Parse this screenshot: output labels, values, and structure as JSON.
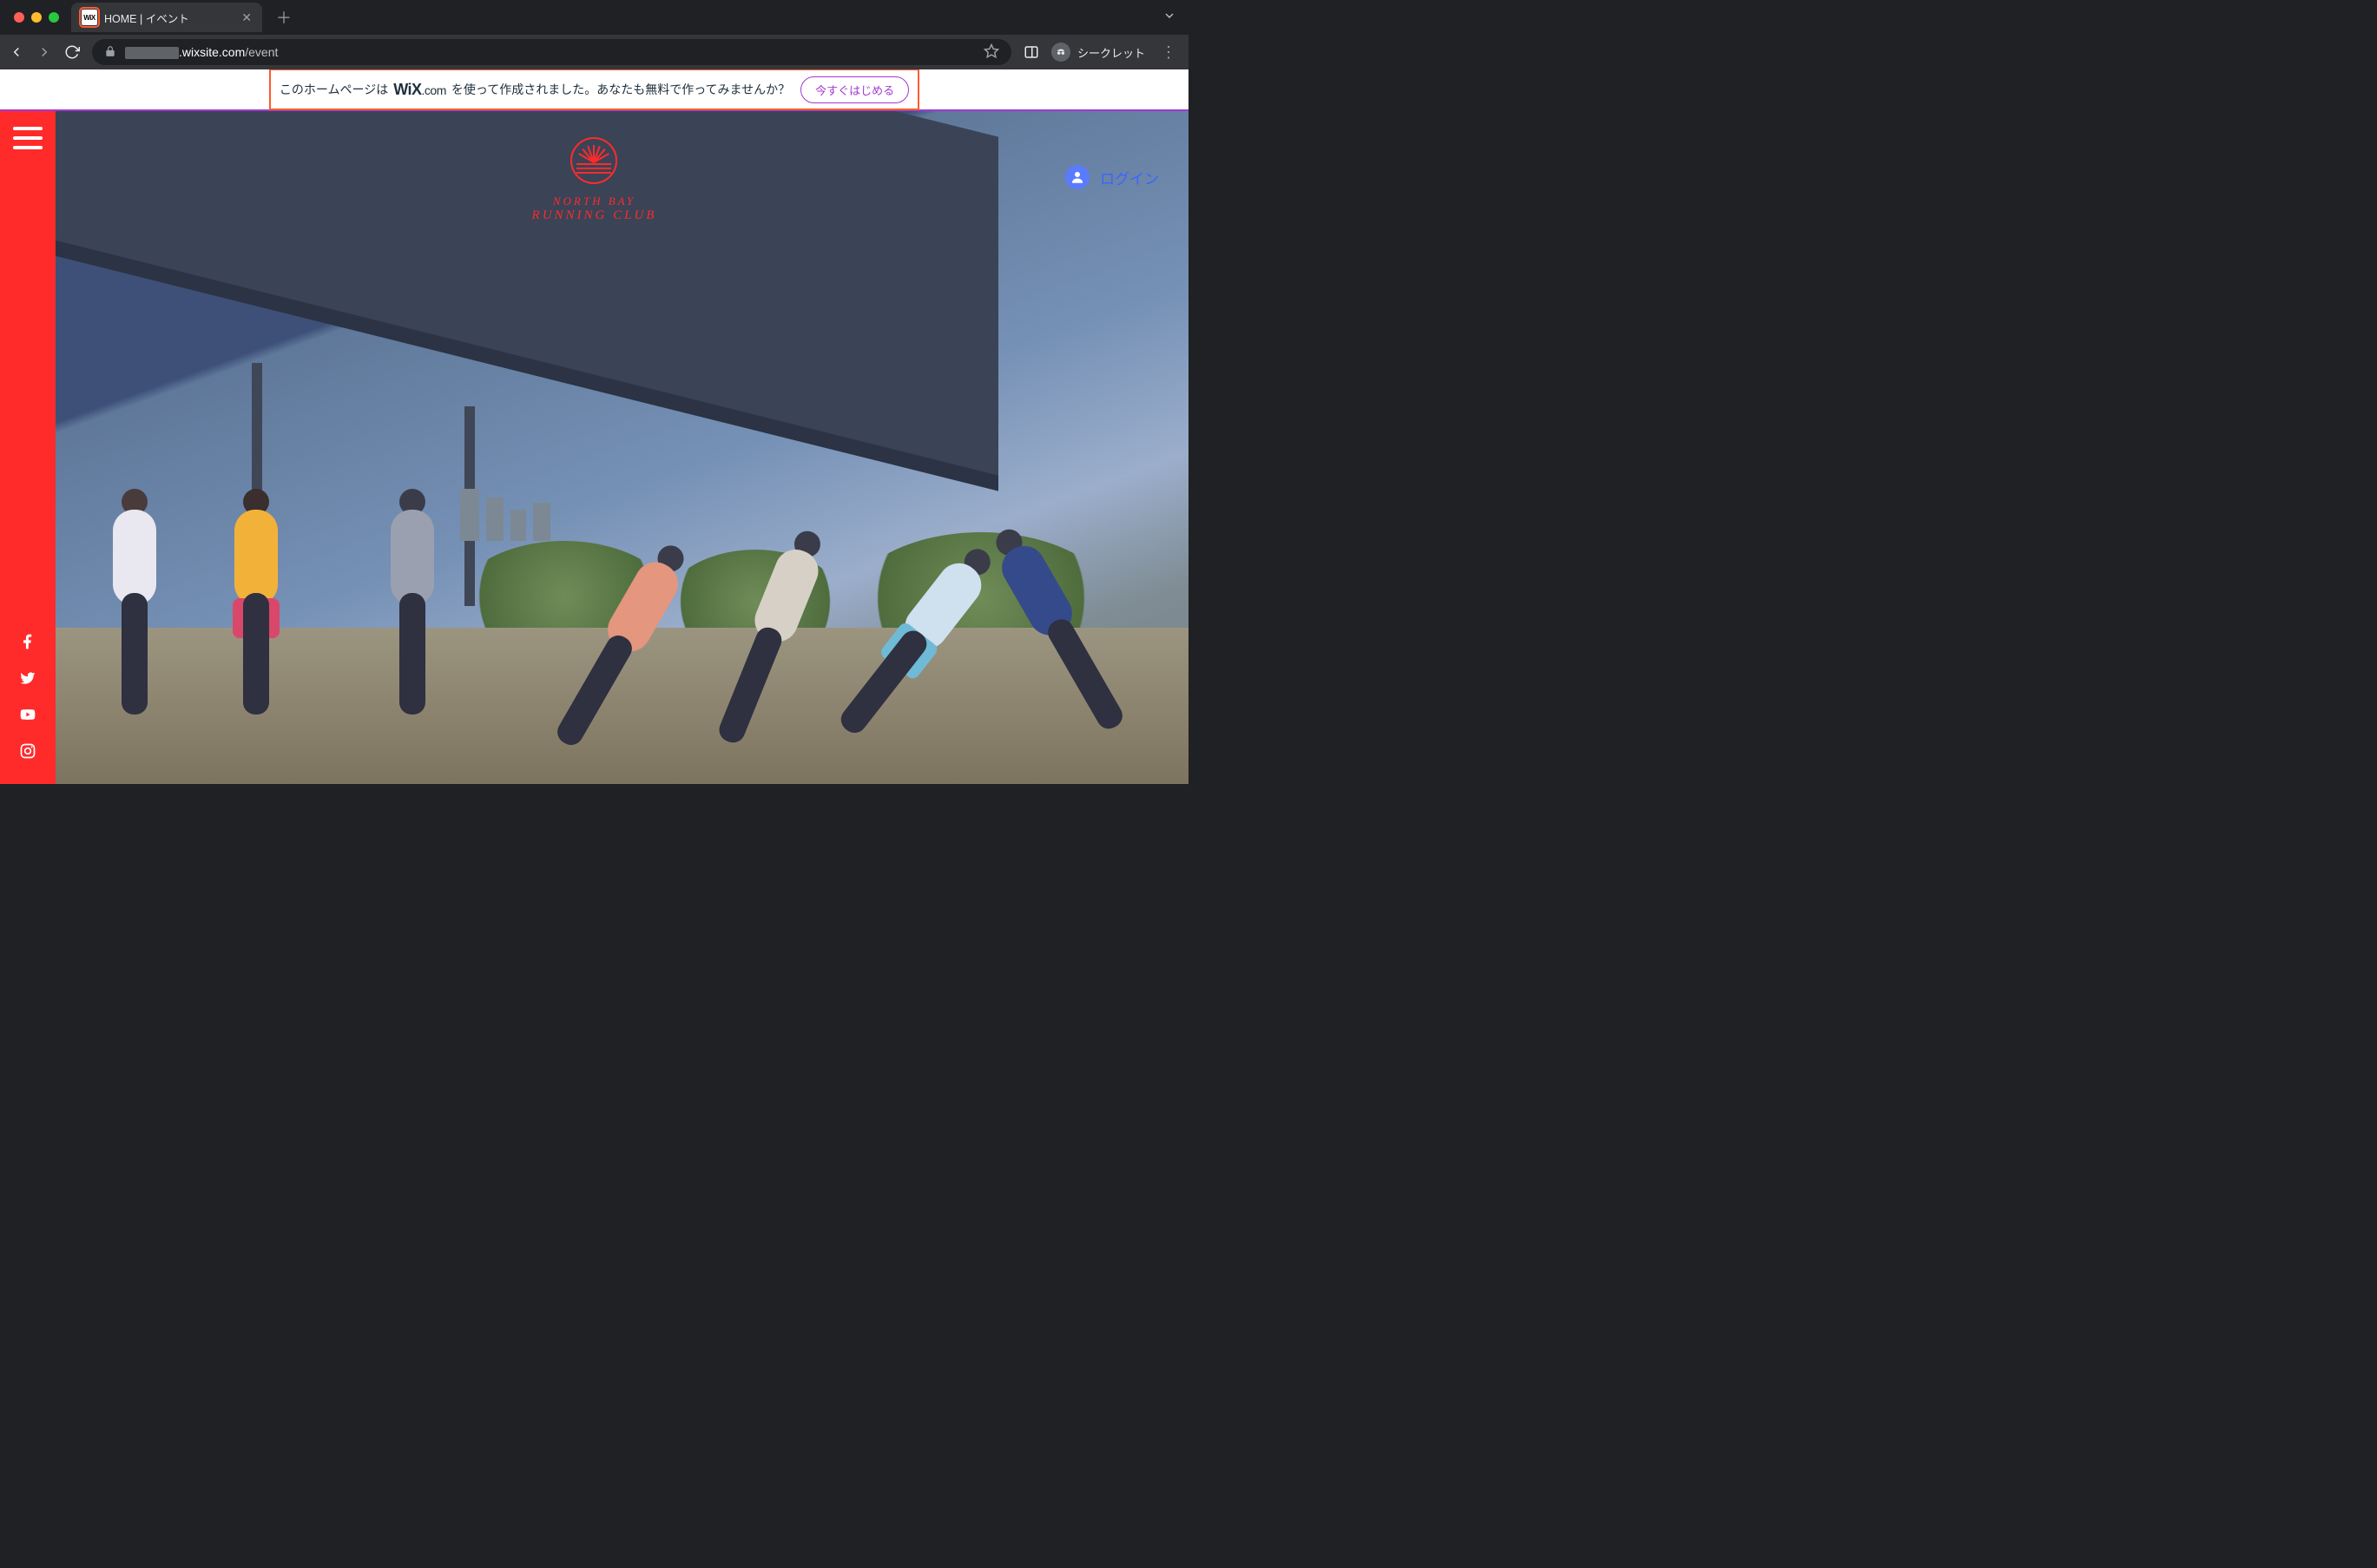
{
  "browser": {
    "tab": {
      "favicon_text": "WiX",
      "title": "HOME | イベント"
    },
    "url": {
      "domain": ".wixsite.com",
      "path": "/event"
    },
    "incognito_label": "シークレット"
  },
  "highlights": {
    "favicon": true,
    "wix_banner": true
  },
  "wix_banner": {
    "text_before": "このホームページは",
    "brand_main": "WiX",
    "brand_suffix": ".com",
    "text_after": "を使って作成されました。あなたも無料で作ってみませんか？",
    "cta": "今すぐはじめる"
  },
  "site": {
    "logo_line1": "NORTH BAY",
    "logo_line2": "RUNNING CLUB"
  },
  "login": {
    "label": "ログイン"
  },
  "social": [
    {
      "name": "facebook-icon"
    },
    {
      "name": "twitter-icon"
    },
    {
      "name": "youtube-icon"
    },
    {
      "name": "instagram-icon"
    }
  ],
  "colors": {
    "accent_red": "#ff2b2b",
    "wix_purple": "#a238cf",
    "login_blue": "#3a64ff",
    "highlight_orange": "#ff5a2f"
  }
}
